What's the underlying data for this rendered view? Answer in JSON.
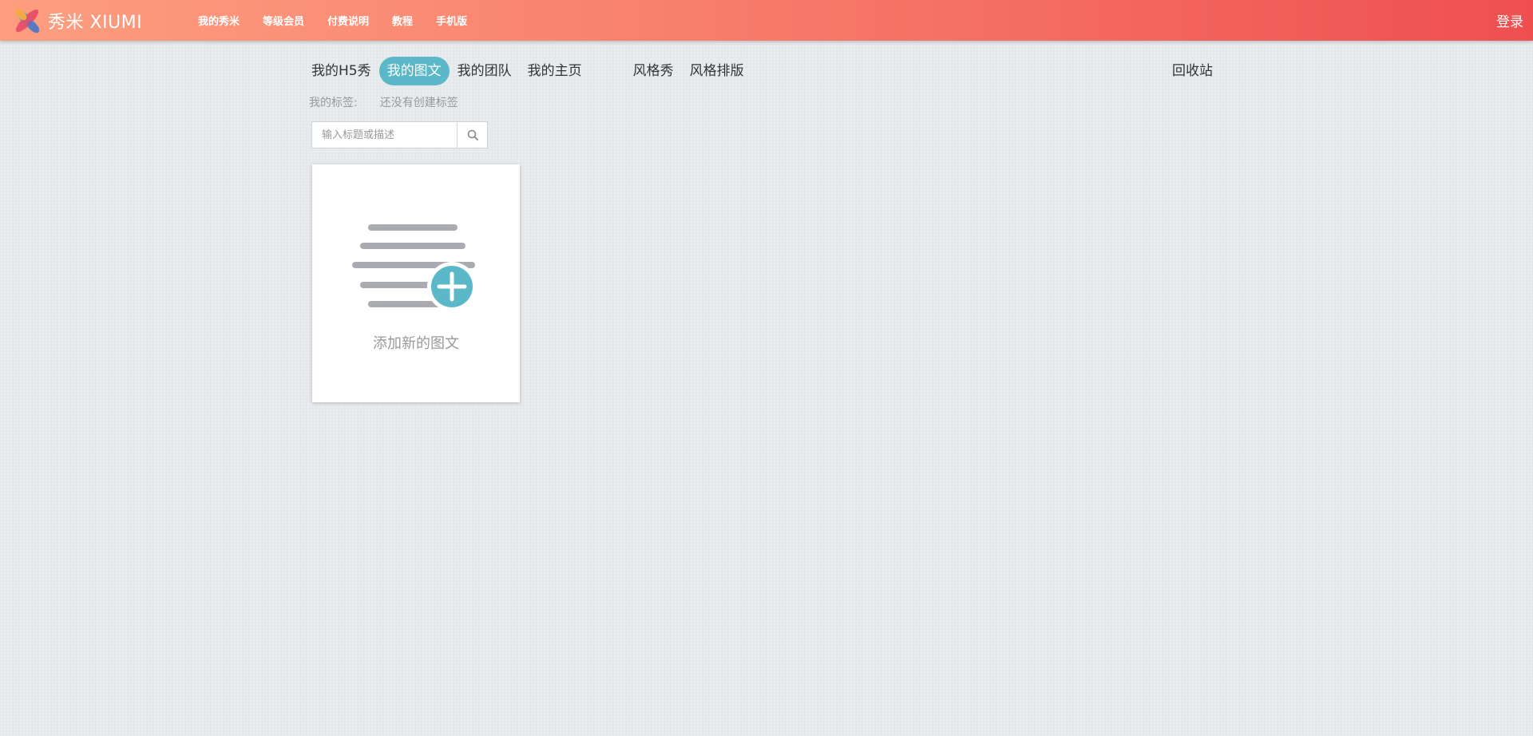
{
  "header": {
    "logo_text": "秀米 XIUMI",
    "nav": [
      "我的秀米",
      "等级会员",
      "付费说明",
      "教程",
      "手机版"
    ],
    "login_label": "登录",
    "gradient_start": "#fd9e7f",
    "gradient_end": "#ef4f4f"
  },
  "tabs": {
    "items": [
      "我的H5秀",
      "我的图文",
      "我的团队",
      "我的主页",
      "风格秀",
      "风格排版"
    ],
    "active": "我的图文",
    "recycle_label": "回收站",
    "active_color": "#5bb8c8"
  },
  "tags": {
    "label": "我的标签:",
    "empty_text": "还没有创建标签"
  },
  "search": {
    "placeholder": "输入标题或描述",
    "value": ""
  },
  "add_card": {
    "label": "添加新的图文",
    "icon": "add-article-icon",
    "accent": "#5bb8c8"
  }
}
